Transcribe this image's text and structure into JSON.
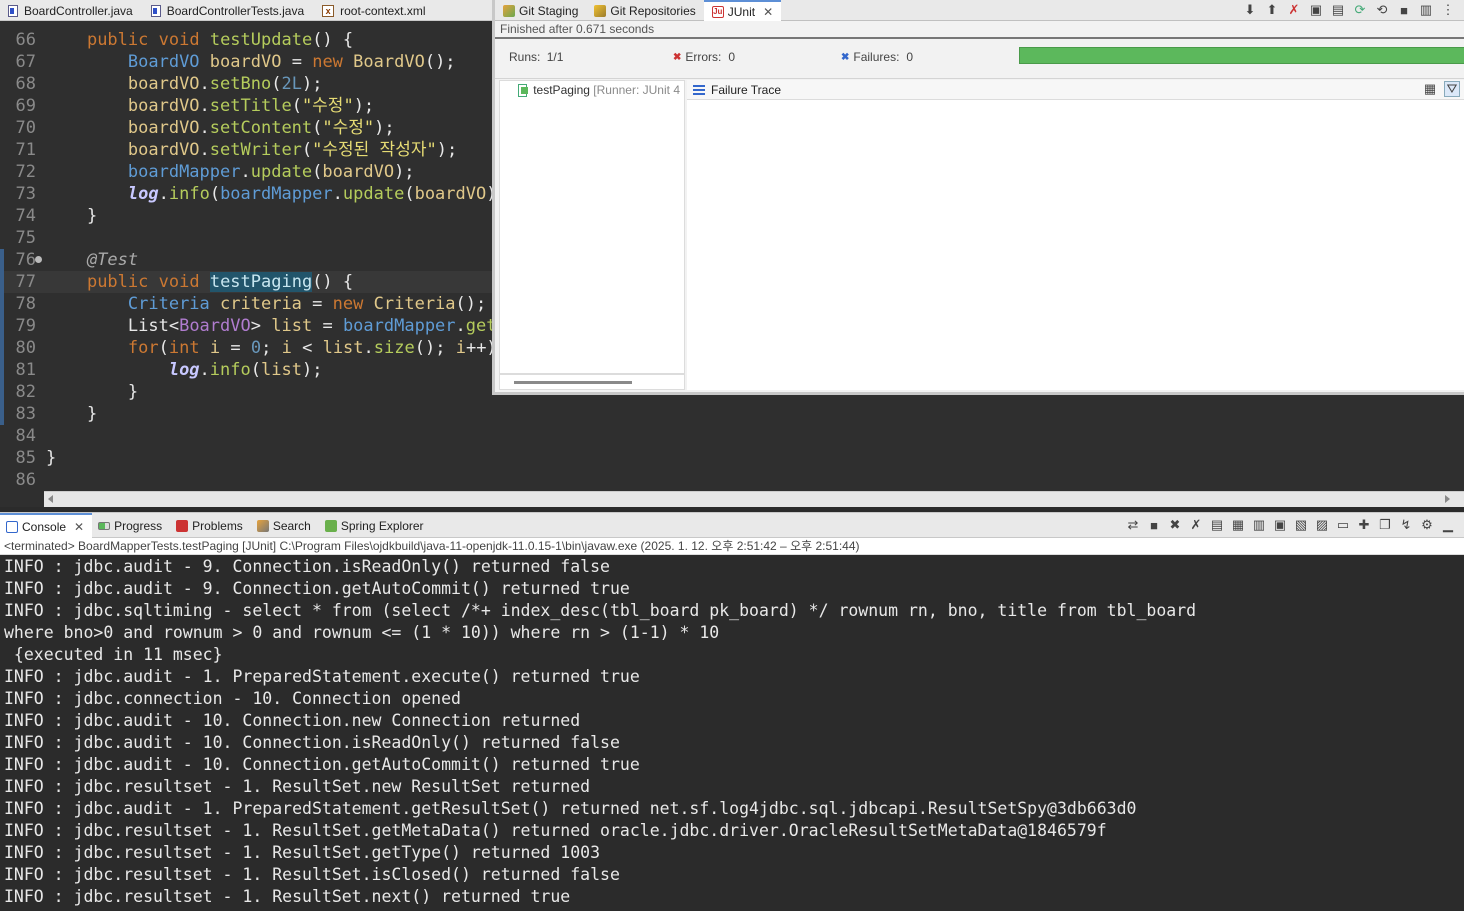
{
  "editor": {
    "tabs": [
      {
        "label": "BoardController.java",
        "icon": "java-file-icon"
      },
      {
        "label": "BoardControllerTests.java",
        "icon": "java-file-icon"
      },
      {
        "label": "root-context.xml",
        "icon": "xml-file-icon"
      }
    ],
    "lines": [
      {
        "num": "66",
        "html": "    <span class=\"kw\">public</span> <span class=\"kw\">void</span> <span class=\"fn\">testUpdate</span><span class=\"pl\">() {</span>"
      },
      {
        "num": "67",
        "html": "        <span class=\"ty\">BoardVO</span> <span class=\"vr\">boardVO</span> <span class=\"pl\">=</span> <span class=\"kw\">new</span> <span class=\"vr\">BoardVO</span><span class=\"pl\">();</span>"
      },
      {
        "num": "68",
        "html": "        <span class=\"vr\">boardVO</span><span class=\"pl\">.</span><span class=\"fn\">setBno</span><span class=\"pl\">(</span><span class=\"nm\">2L</span><span class=\"pl\">);</span>"
      },
      {
        "num": "69",
        "html": "        <span class=\"vr\">boardVO</span><span class=\"pl\">.</span><span class=\"fn\">setTitle</span><span class=\"pl\">(</span><span class=\"st\">\"수정\"</span><span class=\"pl\">);</span>"
      },
      {
        "num": "70",
        "html": "        <span class=\"vr\">boardVO</span><span class=\"pl\">.</span><span class=\"fn\">setContent</span><span class=\"pl\">(</span><span class=\"st\">\"수정\"</span><span class=\"pl\">);</span>"
      },
      {
        "num": "71",
        "html": "        <span class=\"vr\">boardVO</span><span class=\"pl\">.</span><span class=\"fn\">setWriter</span><span class=\"pl\">(</span><span class=\"st\">\"수정된 작성자\"</span><span class=\"pl\">);</span>"
      },
      {
        "num": "72",
        "html": "        <span class=\"ty\">boardMapper</span><span class=\"pl\">.</span><span class=\"fn\">update</span><span class=\"pl\">(</span><span class=\"vr\">boardVO</span><span class=\"pl\">);</span>"
      },
      {
        "num": "73",
        "html": "        <span class=\"lg\">log</span><span class=\"pl\">.</span><span class=\"fn\">info</span><span class=\"pl\">(</span><span class=\"ty\">boardMapper</span><span class=\"pl\">.</span><span class=\"fn\">update</span><span class=\"pl\">(</span><span class=\"vr\">boardVO</span><span class=\"pl\">)</span>"
      },
      {
        "num": "74",
        "html": "    <span class=\"pl\">}</span>"
      },
      {
        "num": "75",
        "html": ""
      },
      {
        "num": "76",
        "html": "    <span class=\"an\">@Test</span>",
        "fold": true
      },
      {
        "num": "77",
        "html": "    <span class=\"kw\">public</span> <span class=\"kw\">void</span> <span class=\"hl\">testPaging</span><span class=\"pl\">() {</span>",
        "current": true
      },
      {
        "num": "78",
        "html": "        <span class=\"ty\">Criteria</span> <span class=\"vr\">criteria</span> <span class=\"pl\">=</span> <span class=\"kw\">new</span> <span class=\"vr\">Criteria</span><span class=\"pl\">(); /</span>"
      },
      {
        "num": "79",
        "html": "        <span class=\"pl\">List&lt;</span><span class=\"vr\" style=\"color:#b07ccf\">BoardVO</span><span class=\"pl\">&gt;</span> <span class=\"vr\">list</span> <span class=\"pl\">=</span> <span class=\"ty\">boardMapper</span><span class=\"pl\">.</span><span class=\"fn\">getL</span>"
      },
      {
        "num": "80",
        "html": "        <span class=\"kw\">for</span><span class=\"pl\">(</span><span class=\"kw\">int</span> <span class=\"vr\">i</span> <span class=\"pl\">=</span> <span class=\"nm\">0</span><span class=\"pl\">;</span> <span class=\"vr\">i</span> <span class=\"pl\">&lt;</span> <span class=\"vr\">list</span><span class=\"pl\">.</span><span class=\"fn\">size</span><span class=\"pl\">();</span> <span class=\"vr\">i</span><span class=\"pl\">++)</span>"
      },
      {
        "num": "81",
        "html": "            <span class=\"lg\">log</span><span class=\"pl\">.</span><span class=\"fn\">info</span><span class=\"pl\">(</span><span class=\"vr\">list</span><span class=\"pl\">);</span>"
      },
      {
        "num": "82",
        "html": "        <span class=\"pl\">}</span>"
      },
      {
        "num": "83",
        "html": "    <span class=\"pl\">}</span>"
      },
      {
        "num": "84",
        "html": ""
      },
      {
        "num": "85",
        "html": "<span class=\"pl\">}</span>"
      },
      {
        "num": "86",
        "html": ""
      }
    ]
  },
  "junit": {
    "tabs": [
      {
        "label": "Git Staging",
        "icon": "git-staging-icon"
      },
      {
        "label": "Git Repositories",
        "icon": "git-repositories-icon"
      },
      {
        "label": "JUnit",
        "icon": "junit-icon",
        "active": true
      }
    ],
    "status": "Finished after 0.671 seconds",
    "runs_label": "Runs:",
    "runs_value": "1/1",
    "errors_label": "Errors:",
    "errors_value": "0",
    "failures_label": "Failures:",
    "failures_value": "0",
    "progress_fraction": 1.0,
    "progress_color": "#5cb85c",
    "tree_item_label": "testPaging",
    "tree_item_runner": "[Runner: JUnit 4",
    "failure_trace_label": "Failure Trace"
  },
  "console": {
    "tabs": [
      {
        "label": "Console",
        "icon": "console-icon",
        "active": true,
        "closable": true
      },
      {
        "label": "Progress",
        "icon": "progress-icon"
      },
      {
        "label": "Problems",
        "icon": "problems-icon"
      },
      {
        "label": "Search",
        "icon": "search-icon"
      },
      {
        "label": "Spring Explorer",
        "icon": "spring-explorer-icon"
      }
    ],
    "status": "<terminated> BoardMapperTests.testPaging [JUnit] C:\\Program Files\\ojdkbuild\\java-11-openjdk-11.0.15-1\\bin\\javaw.exe  (2025. 1. 12. 오후 2:51:42 – 오후 2:51:44)",
    "lines": [
      "INFO : jdbc.audit - 9. Connection.isReadOnly() returned false",
      "INFO : jdbc.audit - 9. Connection.getAutoCommit() returned true",
      "INFO : jdbc.sqltiming - select * from (select /*+ index_desc(tbl_board pk_board) */ rownum rn, bno, title from tbl_board",
      "where bno>0 and rownum > 0 and rownum <= (1 * 10)) where rn > (1-1) * 10",
      " {executed in 11 msec}",
      "INFO : jdbc.audit - 1. PreparedStatement.execute() returned true",
      "INFO : jdbc.connection - 10. Connection opened",
      "INFO : jdbc.audit - 10. Connection.new Connection returned",
      "INFO : jdbc.audit - 10. Connection.isReadOnly() returned false",
      "INFO : jdbc.audit - 10. Connection.getAutoCommit() returned true",
      "INFO : jdbc.resultset - 1. ResultSet.new ResultSet returned",
      "INFO : jdbc.audit - 1. PreparedStatement.getResultSet() returned net.sf.log4jdbc.sql.jdbcapi.ResultSetSpy@3db663d0",
      "INFO : jdbc.resultset - 1. ResultSet.getMetaData() returned oracle.jdbc.driver.OracleResultSetMetaData@1846579f",
      "INFO : jdbc.resultset - 1. ResultSet.getType() returned 1003",
      "INFO : jdbc.resultset - 1. ResultSet.isClosed() returned false",
      "INFO : jdbc.resultset - 1. ResultSet.next() returned true"
    ]
  }
}
